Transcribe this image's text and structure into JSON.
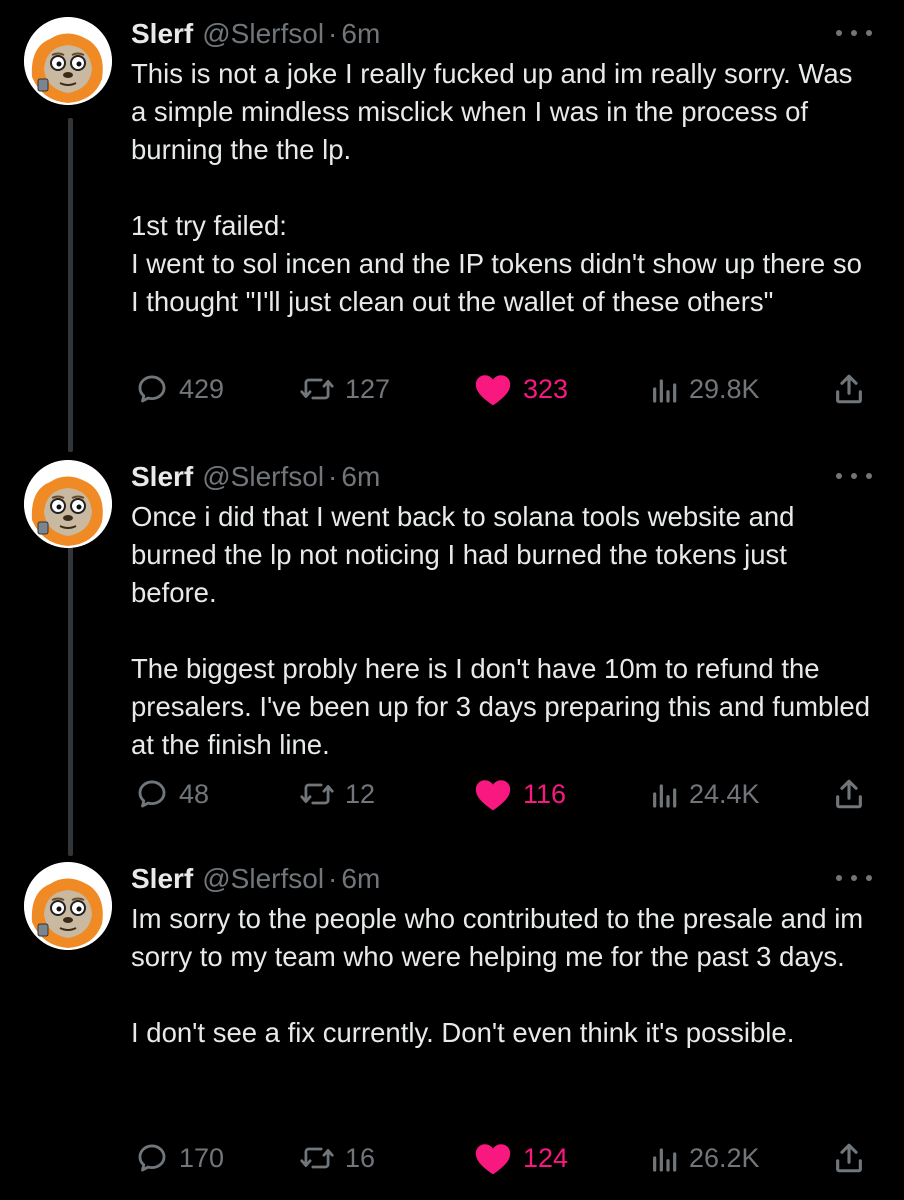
{
  "colors": {
    "background": "#000000",
    "text": "#e7e9ea",
    "muted": "#71767b",
    "like": "#f91880",
    "thread_line": "#333639"
  },
  "tweets": [
    {
      "author": {
        "name": "Slerf",
        "handle": "@Slerfsol",
        "avatar_icon": "sloth-avatar"
      },
      "separator": "·",
      "time": "6m",
      "paragraphs": [
        "This is not a joke I really fucked up and im really sorry. Was a simple mindless misclick when I was in the process of burning the the lp.",
        "1st try failed:\nI went to sol incen and the IP tokens didn't show up there so I thought \"I'll just clean out the wallet of these others\""
      ],
      "stats": {
        "replies": "429",
        "reposts": "127",
        "likes": "323",
        "views": "29.8K",
        "liked": true
      }
    },
    {
      "author": {
        "name": "Slerf",
        "handle": "@Slerfsol",
        "avatar_icon": "sloth-avatar"
      },
      "separator": "·",
      "time": "6m",
      "paragraphs": [
        "Once i did that I went back to solana tools website and burned the lp not noticing I had burned the tokens just before.",
        "The biggest probly here is I don't have 10m to refund the presalers. I've been up for 3 days preparing this and fumbled at the finish line."
      ],
      "stats": {
        "replies": "48",
        "reposts": "12",
        "likes": "116",
        "views": "24.4K",
        "liked": true
      }
    },
    {
      "author": {
        "name": "Slerf",
        "handle": "@Slerfsol",
        "avatar_icon": "sloth-avatar"
      },
      "separator": "·",
      "time": "6m",
      "paragraphs": [
        "Im sorry to the people who contributed to the presale and im sorry to my team who were helping me for the past 3 days.",
        "I don't see a fix currently. Don't even think it's possible."
      ],
      "stats": {
        "replies": "170",
        "reposts": "16",
        "likes": "124",
        "views": "26.2K",
        "liked": true
      }
    }
  ]
}
